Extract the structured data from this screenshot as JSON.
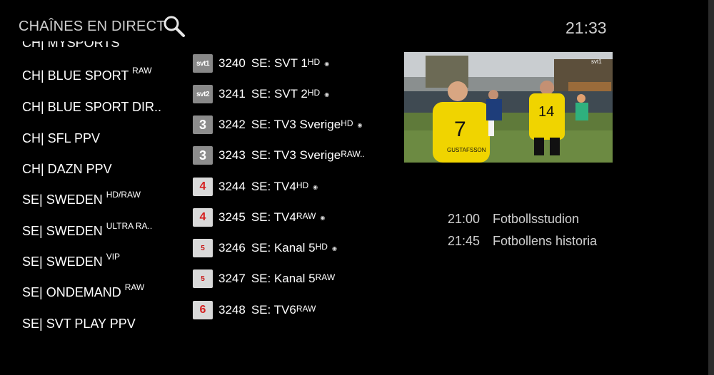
{
  "header": {
    "title": "CHAÎNES EN DIRECT",
    "clock": "21:33"
  },
  "categories": [
    {
      "label": "CH| MYSPORTS",
      "sup": ""
    },
    {
      "label": "CH| BLUE SPORT ",
      "sup": "RAW"
    },
    {
      "label": "CH| BLUE SPORT DIR..",
      "sup": ""
    },
    {
      "label": "CH| SFL PPV",
      "sup": ""
    },
    {
      "label": "CH| DAZN PPV",
      "sup": ""
    },
    {
      "label": "SE| SWEDEN ",
      "sup": "HD/RAW"
    },
    {
      "label": "SE| SWEDEN ",
      "sup": "ULTRA RA.."
    },
    {
      "label": "SE| SWEDEN ",
      "sup": "VIP"
    },
    {
      "label": "SE| ONDEMAND ",
      "sup": "RAW"
    },
    {
      "label": "SE| SVT PLAY PPV",
      "sup": ""
    }
  ],
  "channels": [
    {
      "logo": "svt1",
      "number": "3240",
      "name": "SE: SVT 1 ",
      "sup": "HD",
      "marker": "◉"
    },
    {
      "logo": "svt2",
      "number": "3241",
      "name": "SE: SVT 2 ",
      "sup": "HD",
      "marker": "◉"
    },
    {
      "logo": "3",
      "number": "3242",
      "name": "SE: TV3 Sverige ",
      "sup": "HD",
      "marker": "◉"
    },
    {
      "logo": "3",
      "number": "3243",
      "name": "SE: TV3 Sverige ",
      "sup": "RAW..",
      "marker": ""
    },
    {
      "logo": "4",
      "number": "3244",
      "name": "SE: TV4 ",
      "sup": "HD",
      "marker": "◉"
    },
    {
      "logo": "4",
      "number": "3245",
      "name": "SE: TV4 ",
      "sup": "RAW",
      "marker": "◉"
    },
    {
      "logo": "5",
      "number": "3246",
      "name": "SE: Kanal 5 ",
      "sup": "HD",
      "marker": "◉"
    },
    {
      "logo": "5",
      "number": "3247",
      "name": "SE: Kanal 5 ",
      "sup": "RAW",
      "marker": ""
    },
    {
      "logo": "6",
      "number": "3248",
      "name": "SE: TV6 ",
      "sup": "RAW",
      "marker": ""
    }
  ],
  "preview": {
    "channel_bug": "svt1",
    "player_numbers": [
      "7",
      "14"
    ],
    "player_name": "GUSTAFSSON"
  },
  "epg": [
    {
      "time": "21:00",
      "title": "Fotbollsstudion"
    },
    {
      "time": "21:45",
      "title": "Fotbollens historia"
    }
  ],
  "icons": {
    "search": "search-icon"
  },
  "colors": {
    "background": "#000000",
    "text": "#ffffff",
    "muted": "#cfcfcf"
  }
}
